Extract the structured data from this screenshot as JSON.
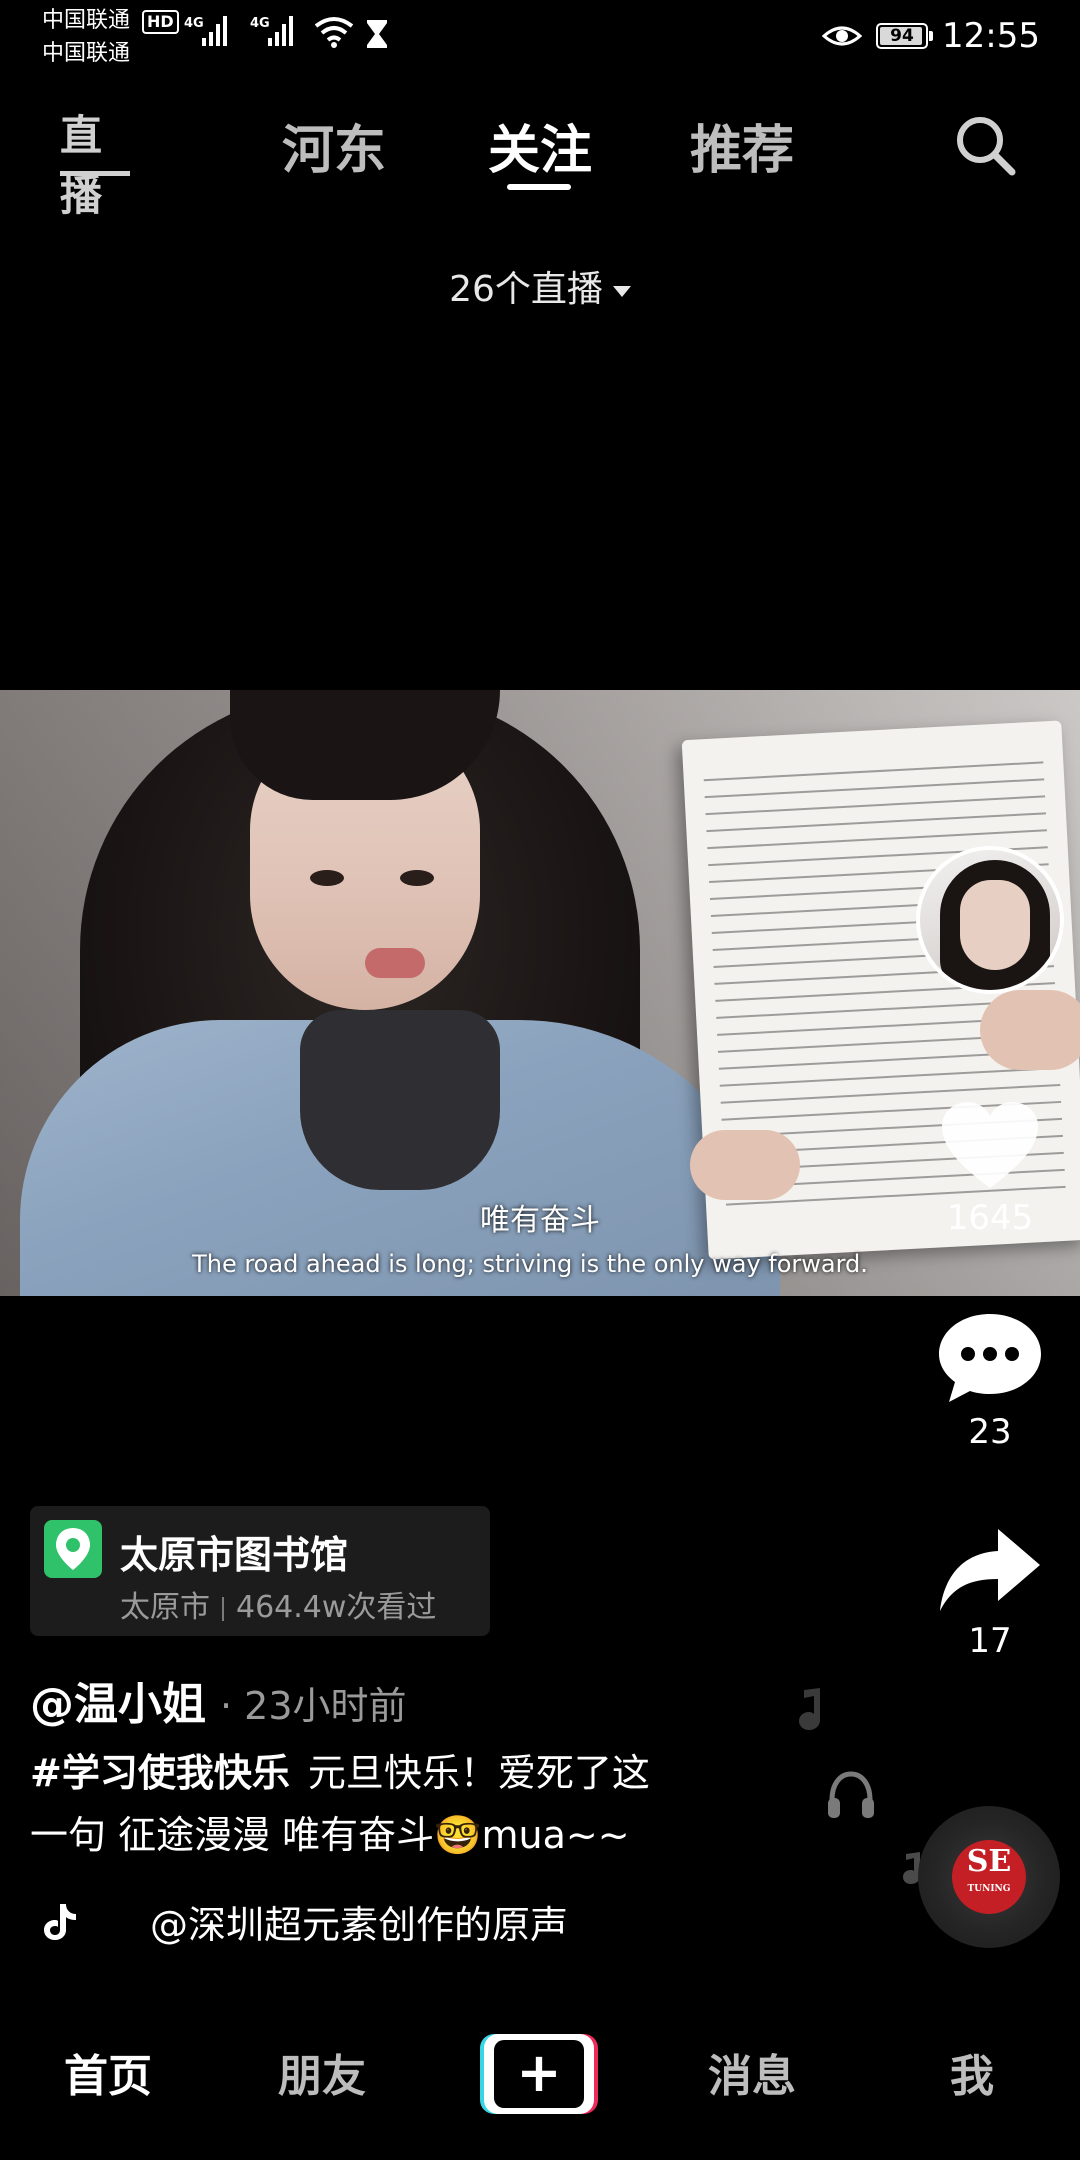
{
  "status_bar": {
    "carrier1": "中国联通",
    "carrier2": "中国联通",
    "hd_badge": "HD",
    "network1": "4G",
    "network2": "4G",
    "battery": "94",
    "time": "12:55"
  },
  "top_nav": {
    "live_label": "直播",
    "tabs": [
      "河东",
      "关注",
      "推荐"
    ],
    "active_tab": "关注"
  },
  "live_count": "26个直播",
  "video": {
    "subtitle_cn": "唯有奋斗",
    "subtitle_en": "The road ahead is long; striving is the only way forward."
  },
  "actions": {
    "likes": "1645",
    "comments": "23",
    "shares": "17"
  },
  "location": {
    "name": "太原市图书馆",
    "city": "太原市",
    "views": "464.4w次看过"
  },
  "post": {
    "author": "@温小姐",
    "time": "· 23小时前",
    "hashtag": "#学习使我快乐",
    "caption_line1": "元旦快乐！爱死了这",
    "caption_line2": "一句 征途漫漫 唯有奋斗🤓mua~~"
  },
  "music": {
    "text": "@深圳超元素创作的原声",
    "disc_logo": "SE",
    "disc_sub": "TUNING"
  },
  "bottom_nav": {
    "home": "首页",
    "friends": "朋友",
    "create": "+",
    "messages": "消息",
    "me": "我"
  },
  "colors": {
    "background": "#000000",
    "location_pin": "#2fc26a",
    "plus_cyan": "#38d6e5",
    "plus_red": "#ee2a5b"
  }
}
